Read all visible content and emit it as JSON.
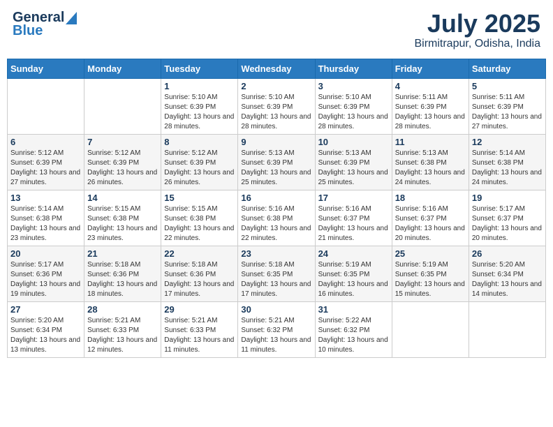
{
  "header": {
    "logo_general": "General",
    "logo_blue": "Blue",
    "month_year": "July 2025",
    "location": "Birmitrapur, Odisha, India"
  },
  "weekdays": [
    "Sunday",
    "Monday",
    "Tuesday",
    "Wednesday",
    "Thursday",
    "Friday",
    "Saturday"
  ],
  "weeks": [
    [
      {
        "day": "",
        "sunrise": "",
        "sunset": "",
        "daylight": ""
      },
      {
        "day": "",
        "sunrise": "",
        "sunset": "",
        "daylight": ""
      },
      {
        "day": "1",
        "sunrise": "Sunrise: 5:10 AM",
        "sunset": "Sunset: 6:39 PM",
        "daylight": "Daylight: 13 hours and 28 minutes."
      },
      {
        "day": "2",
        "sunrise": "Sunrise: 5:10 AM",
        "sunset": "Sunset: 6:39 PM",
        "daylight": "Daylight: 13 hours and 28 minutes."
      },
      {
        "day": "3",
        "sunrise": "Sunrise: 5:10 AM",
        "sunset": "Sunset: 6:39 PM",
        "daylight": "Daylight: 13 hours and 28 minutes."
      },
      {
        "day": "4",
        "sunrise": "Sunrise: 5:11 AM",
        "sunset": "Sunset: 6:39 PM",
        "daylight": "Daylight: 13 hours and 28 minutes."
      },
      {
        "day": "5",
        "sunrise": "Sunrise: 5:11 AM",
        "sunset": "Sunset: 6:39 PM",
        "daylight": "Daylight: 13 hours and 27 minutes."
      }
    ],
    [
      {
        "day": "6",
        "sunrise": "Sunrise: 5:12 AM",
        "sunset": "Sunset: 6:39 PM",
        "daylight": "Daylight: 13 hours and 27 minutes."
      },
      {
        "day": "7",
        "sunrise": "Sunrise: 5:12 AM",
        "sunset": "Sunset: 6:39 PM",
        "daylight": "Daylight: 13 hours and 26 minutes."
      },
      {
        "day": "8",
        "sunrise": "Sunrise: 5:12 AM",
        "sunset": "Sunset: 6:39 PM",
        "daylight": "Daylight: 13 hours and 26 minutes."
      },
      {
        "day": "9",
        "sunrise": "Sunrise: 5:13 AM",
        "sunset": "Sunset: 6:39 PM",
        "daylight": "Daylight: 13 hours and 25 minutes."
      },
      {
        "day": "10",
        "sunrise": "Sunrise: 5:13 AM",
        "sunset": "Sunset: 6:39 PM",
        "daylight": "Daylight: 13 hours and 25 minutes."
      },
      {
        "day": "11",
        "sunrise": "Sunrise: 5:13 AM",
        "sunset": "Sunset: 6:38 PM",
        "daylight": "Daylight: 13 hours and 24 minutes."
      },
      {
        "day": "12",
        "sunrise": "Sunrise: 5:14 AM",
        "sunset": "Sunset: 6:38 PM",
        "daylight": "Daylight: 13 hours and 24 minutes."
      }
    ],
    [
      {
        "day": "13",
        "sunrise": "Sunrise: 5:14 AM",
        "sunset": "Sunset: 6:38 PM",
        "daylight": "Daylight: 13 hours and 23 minutes."
      },
      {
        "day": "14",
        "sunrise": "Sunrise: 5:15 AM",
        "sunset": "Sunset: 6:38 PM",
        "daylight": "Daylight: 13 hours and 23 minutes."
      },
      {
        "day": "15",
        "sunrise": "Sunrise: 5:15 AM",
        "sunset": "Sunset: 6:38 PM",
        "daylight": "Daylight: 13 hours and 22 minutes."
      },
      {
        "day": "16",
        "sunrise": "Sunrise: 5:16 AM",
        "sunset": "Sunset: 6:38 PM",
        "daylight": "Daylight: 13 hours and 22 minutes."
      },
      {
        "day": "17",
        "sunrise": "Sunrise: 5:16 AM",
        "sunset": "Sunset: 6:37 PM",
        "daylight": "Daylight: 13 hours and 21 minutes."
      },
      {
        "day": "18",
        "sunrise": "Sunrise: 5:16 AM",
        "sunset": "Sunset: 6:37 PM",
        "daylight": "Daylight: 13 hours and 20 minutes."
      },
      {
        "day": "19",
        "sunrise": "Sunrise: 5:17 AM",
        "sunset": "Sunset: 6:37 PM",
        "daylight": "Daylight: 13 hours and 20 minutes."
      }
    ],
    [
      {
        "day": "20",
        "sunrise": "Sunrise: 5:17 AM",
        "sunset": "Sunset: 6:36 PM",
        "daylight": "Daylight: 13 hours and 19 minutes."
      },
      {
        "day": "21",
        "sunrise": "Sunrise: 5:18 AM",
        "sunset": "Sunset: 6:36 PM",
        "daylight": "Daylight: 13 hours and 18 minutes."
      },
      {
        "day": "22",
        "sunrise": "Sunrise: 5:18 AM",
        "sunset": "Sunset: 6:36 PM",
        "daylight": "Daylight: 13 hours and 17 minutes."
      },
      {
        "day": "23",
        "sunrise": "Sunrise: 5:18 AM",
        "sunset": "Sunset: 6:35 PM",
        "daylight": "Daylight: 13 hours and 17 minutes."
      },
      {
        "day": "24",
        "sunrise": "Sunrise: 5:19 AM",
        "sunset": "Sunset: 6:35 PM",
        "daylight": "Daylight: 13 hours and 16 minutes."
      },
      {
        "day": "25",
        "sunrise": "Sunrise: 5:19 AM",
        "sunset": "Sunset: 6:35 PM",
        "daylight": "Daylight: 13 hours and 15 minutes."
      },
      {
        "day": "26",
        "sunrise": "Sunrise: 5:20 AM",
        "sunset": "Sunset: 6:34 PM",
        "daylight": "Daylight: 13 hours and 14 minutes."
      }
    ],
    [
      {
        "day": "27",
        "sunrise": "Sunrise: 5:20 AM",
        "sunset": "Sunset: 6:34 PM",
        "daylight": "Daylight: 13 hours and 13 minutes."
      },
      {
        "day": "28",
        "sunrise": "Sunrise: 5:21 AM",
        "sunset": "Sunset: 6:33 PM",
        "daylight": "Daylight: 13 hours and 12 minutes."
      },
      {
        "day": "29",
        "sunrise": "Sunrise: 5:21 AM",
        "sunset": "Sunset: 6:33 PM",
        "daylight": "Daylight: 13 hours and 11 minutes."
      },
      {
        "day": "30",
        "sunrise": "Sunrise: 5:21 AM",
        "sunset": "Sunset: 6:32 PM",
        "daylight": "Daylight: 13 hours and 11 minutes."
      },
      {
        "day": "31",
        "sunrise": "Sunrise: 5:22 AM",
        "sunset": "Sunset: 6:32 PM",
        "daylight": "Daylight: 13 hours and 10 minutes."
      },
      {
        "day": "",
        "sunrise": "",
        "sunset": "",
        "daylight": ""
      },
      {
        "day": "",
        "sunrise": "",
        "sunset": "",
        "daylight": ""
      }
    ]
  ]
}
